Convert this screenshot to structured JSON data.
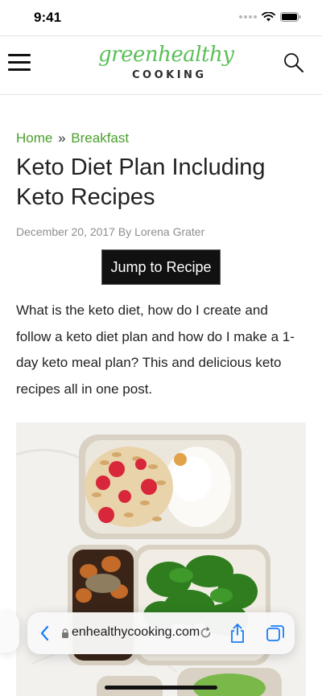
{
  "status": {
    "time": "9:41"
  },
  "header": {
    "logo_script": "greenhealthy",
    "logo_caps": "COOKING",
    "menu_icon": "hamburger-menu-icon",
    "search_icon": "search-icon"
  },
  "breadcrumb": {
    "home": "Home",
    "separator": "»",
    "category": "Breakfast"
  },
  "article": {
    "title": "Keto Diet Plan Including Keto Recipes",
    "meta": "December 20, 2017 By Lorena Grater",
    "jump_label": "Jump to Recipe",
    "intro": "What is the keto diet, how do I create and follow a keto diet plan and how do I make a 1-day keto meal plan? This and delicious keto recipes all in one post."
  },
  "browser": {
    "url": "enhealthycooking.com"
  },
  "colors": {
    "brand_green": "#5bbf58",
    "link_green": "#4a9f2c",
    "button_bg": "#111111",
    "ios_blue": "#1a7cf5"
  }
}
